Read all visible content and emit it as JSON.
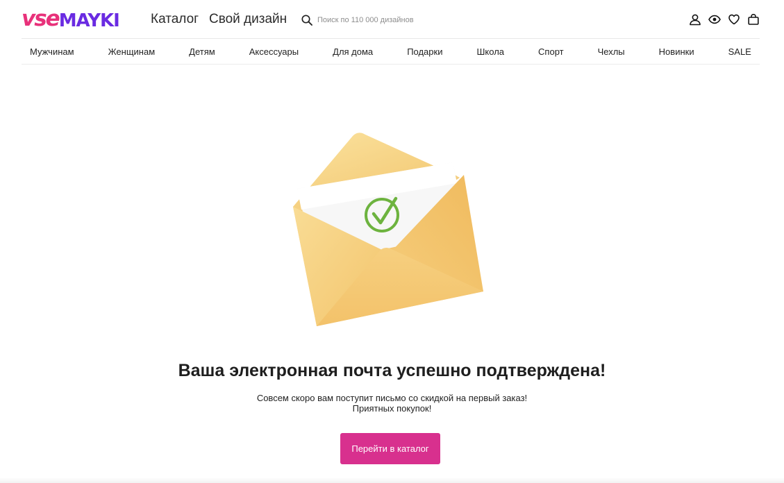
{
  "header": {
    "logo": {
      "part1": "vse",
      "part2": "MAYKI"
    },
    "links": {
      "catalog": "Каталог",
      "own_design": "Свой дизайн"
    },
    "search": {
      "placeholder": "Поиск по 110 000 дизайнов"
    },
    "icons": [
      "user-icon",
      "eye-icon",
      "heart-icon",
      "bag-icon"
    ]
  },
  "nav": {
    "items": [
      "Мужчинам",
      "Женщинам",
      "Детям",
      "Аксессуары",
      "Для дома",
      "Подарки",
      "Школа",
      "Спорт",
      "Чехлы",
      "Новинки",
      "SALE"
    ]
  },
  "main": {
    "illustration": "envelope-check-icon",
    "headline": "Ваша электронная почта успешно подтверждена!",
    "line1": "Совсем скоро вам поступит письмо со скидкой на первый заказ!",
    "line2": "Приятных покупок!",
    "button": "Перейти в каталог"
  },
  "colors": {
    "brand_pink": "#e8317a",
    "brand_purple": "#6a2be2",
    "button": "#d8308e",
    "check_green": "#6db33f",
    "envelope": "#f2c064"
  }
}
